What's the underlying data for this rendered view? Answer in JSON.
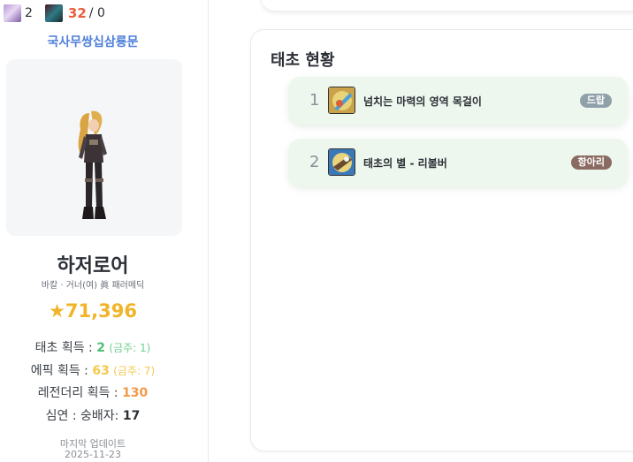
{
  "sidebar": {
    "counters": {
      "icon_a": "character-icon",
      "count_a": "2",
      "icon_b": "creature-icon",
      "count_b": "32",
      "count_b_suffix": "/ 0"
    },
    "guild": "국사무쌍십삼룡문",
    "character": {
      "name": "하저로어",
      "info": "바칼 · 거너(여) 眞 패러메딕",
      "fame": "71,396",
      "fame_icon": "star-icon"
    },
    "stats": [
      {
        "label": "태초 획득 : ",
        "value": "2",
        "sub": "(금주: 1)"
      },
      {
        "label": "에픽 획득 : ",
        "value": "63",
        "sub": "(금주: 7)"
      },
      {
        "label": "레전더리 획득 : ",
        "value": "130"
      },
      {
        "label": "심연 : 숭배자: ",
        "value": "17"
      }
    ],
    "updated_label": "마지막 업데이트",
    "updated_date": "2025-11-23"
  },
  "main": {
    "panel_title": "태초 현황",
    "items": [
      {
        "rank": "1",
        "name": "넘치는 마력의 영역 목걸이",
        "badge": "드랍",
        "badge_color": "#8fa0a8"
      },
      {
        "rank": "2",
        "name": "태초의 별 - 리볼버",
        "badge": "항아리",
        "badge_color": "#8a6b62"
      }
    ]
  },
  "colors": {
    "accent_blue": "#4f7fd8",
    "fame_gold": "#f0b429",
    "green": "#4cbf73",
    "orange": "#f2994a",
    "row_bg": "#eef7ee"
  }
}
